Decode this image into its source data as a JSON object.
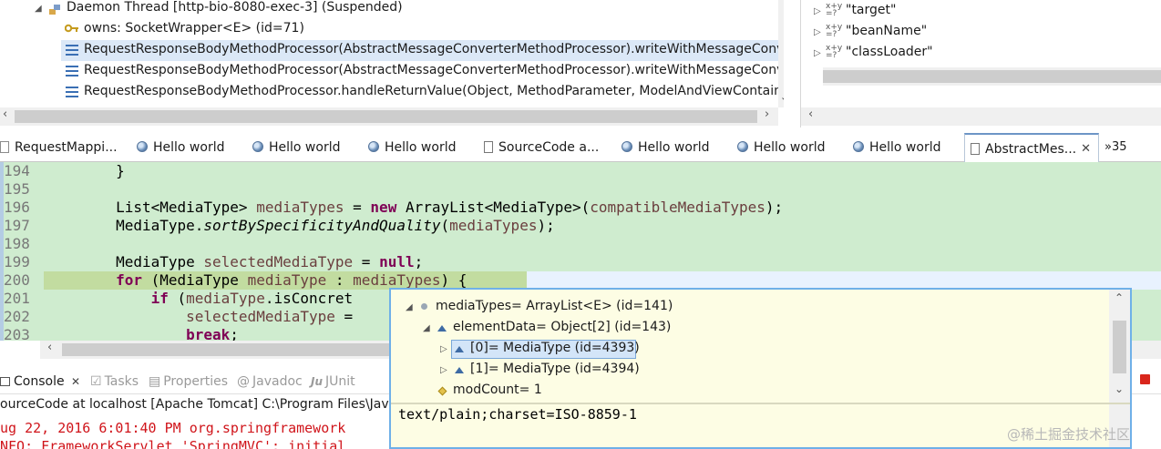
{
  "debug": {
    "thread_label": "Daemon Thread [http-bio-8080-exec-3] (Suspended)",
    "owns_label": "owns: SocketWrapper<E>  (id=71)",
    "frames": [
      "RequestResponseBodyMethodProcessor(AbstractMessageConverterMethodProcessor).writeWithMessageConverters",
      "RequestResponseBodyMethodProcessor(AbstractMessageConverterMethodProcessor).writeWithMessageConverters",
      "RequestResponseBodyMethodProcessor.handleReturnValue(Object, MethodParameter, ModelAndViewContainer, N"
    ]
  },
  "variables": {
    "rows": [
      "\"target\"",
      "\"beanName\"",
      "\"classLoader\""
    ]
  },
  "editor_tabs": [
    {
      "label": "RequestMappi...",
      "icon": "java-class-icon"
    },
    {
      "label": "Hello world",
      "icon": "globe-icon"
    },
    {
      "label": "Hello world",
      "icon": "globe-icon"
    },
    {
      "label": "Hello world",
      "icon": "globe-icon"
    },
    {
      "label": "SourceCode a...",
      "icon": "source-file-icon"
    },
    {
      "label": "Hello world",
      "icon": "globe-icon"
    },
    {
      "label": "Hello world",
      "icon": "globe-icon"
    },
    {
      "label": "Hello world",
      "icon": "globe-icon"
    },
    {
      "label": "AbstractMes...",
      "icon": "class-file-icon",
      "active": true
    }
  ],
  "editor_tabs_overflow": "»35",
  "code": {
    "line_numbers": [
      "194",
      "195",
      "196",
      "197",
      "198",
      "199",
      "200",
      "201",
      "202",
      "203"
    ],
    "lines": [
      {
        "segs": [
          [
            "plain",
            "        }"
          ]
        ]
      },
      {
        "segs": [
          [
            "plain",
            ""
          ]
        ]
      },
      {
        "segs": [
          [
            "plain",
            "        List<MediaType> "
          ],
          [
            "var",
            "mediaTypes"
          ],
          [
            "plain",
            " = "
          ],
          [
            "kw",
            "new"
          ],
          [
            "plain",
            " ArrayList<MediaType>("
          ],
          [
            "var",
            "compatibleMediaTypes"
          ],
          [
            "plain",
            ");"
          ]
        ]
      },
      {
        "segs": [
          [
            "plain",
            "        MediaType."
          ],
          [
            "sm",
            "sortBySpecificityAndQuality"
          ],
          [
            "plain",
            "("
          ],
          [
            "var",
            "mediaTypes"
          ],
          [
            "plain",
            ");"
          ]
        ]
      },
      {
        "segs": [
          [
            "plain",
            ""
          ]
        ]
      },
      {
        "segs": [
          [
            "plain",
            "        MediaType "
          ],
          [
            "var",
            "selectedMediaType"
          ],
          [
            "plain",
            " = "
          ],
          [
            "kw",
            "null"
          ],
          [
            "plain",
            ";"
          ]
        ]
      },
      {
        "segs": [
          [
            "plain",
            "        "
          ],
          [
            "kw",
            "for"
          ],
          [
            "plain",
            " (MediaType "
          ],
          [
            "var",
            "mediaType"
          ],
          [
            "plain",
            " : "
          ],
          [
            "var",
            "mediaTypes"
          ],
          [
            "plain",
            ") {"
          ]
        ]
      },
      {
        "segs": [
          [
            "plain",
            "            "
          ],
          [
            "kw",
            "if"
          ],
          [
            "plain",
            " ("
          ],
          [
            "var",
            "mediaType"
          ],
          [
            "plain",
            ".isConcret"
          ]
        ]
      },
      {
        "segs": [
          [
            "plain",
            "                "
          ],
          [
            "var",
            "selectedMediaType"
          ],
          [
            "plain",
            " ="
          ]
        ]
      },
      {
        "segs": [
          [
            "plain",
            "                "
          ],
          [
            "kw",
            "break"
          ],
          [
            "plain",
            ";"
          ]
        ]
      }
    ]
  },
  "bottom_tabs": [
    {
      "label": "Console",
      "active": true,
      "icon": "console-icon"
    },
    {
      "label": "Tasks",
      "icon": "tasks-icon"
    },
    {
      "label": "Properties",
      "icon": "properties-icon"
    },
    {
      "label": "Javadoc",
      "icon": "javadoc-icon"
    },
    {
      "label": "JUnit",
      "icon": "junit-icon"
    }
  ],
  "console": {
    "header": "ourceCode at localhost [Apache Tomcat] C:\\Program Files\\Java\\j",
    "lines": [
      "ug 22, 2016 6:01:40 PM org.springframework",
      "NFO: FrameworkServlet 'SpringMVC': initial"
    ]
  },
  "popup": {
    "rows": [
      {
        "label": "mediaTypes= ArrayList<E>  (id=141)"
      },
      {
        "label": "elementData= Object[2]  (id=143)"
      },
      {
        "label": "[0]= MediaType  (id=4393)",
        "selected": true
      },
      {
        "label": "[1]= MediaType  (id=4394)"
      },
      {
        "label": "modCount= 1"
      }
    ],
    "detail": "text/plain;charset=ISO-8859-1"
  },
  "watermark": "@稀土掘金技术社区"
}
